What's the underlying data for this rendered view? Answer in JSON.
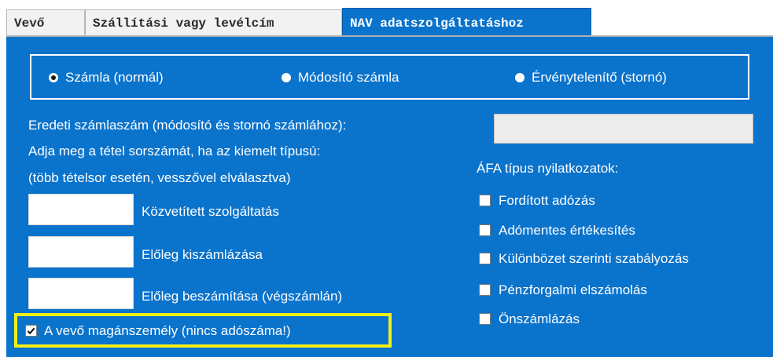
{
  "tabs": [
    {
      "label": "Vevő"
    },
    {
      "label": "Szállítási vagy levélcím"
    },
    {
      "label": "NAV adatszolgáltatáshoz"
    }
  ],
  "invoice_type": {
    "options": [
      "Számla (normál)",
      "Módosító számla",
      "Érvénytelenítő (stornó)"
    ],
    "selected": "Számla (normál)"
  },
  "original_invoice": {
    "label": "Eredeti számlaszám (módosító és stornó számlához):",
    "value": ""
  },
  "item_instructions": {
    "line1": "Adja meg a tétel sorszámát, ha az kiemelt típusú:",
    "line2": "(több tételsor esetén, vesszővel elválasztva)"
  },
  "item_fields": [
    {
      "label": "Közvetített szolgáltatás",
      "value": ""
    },
    {
      "label": "Előleg kiszámlázása",
      "value": ""
    },
    {
      "label": "Előleg beszámítása (végszámlán)",
      "value": ""
    }
  ],
  "vat": {
    "title": "ÁFA típus nyilatkozatok:",
    "options": [
      {
        "label": "Fordított adózás",
        "checked": false
      },
      {
        "label": "Adómentes értékesítés",
        "checked": false
      },
      {
        "label": "Különbözet szerinti szabályozás",
        "checked": false
      },
      {
        "label": "Pénzforgalmi elszámolás",
        "checked": false
      },
      {
        "label": "Önszámlázás",
        "checked": false
      }
    ]
  },
  "private_person": {
    "label": "A vevő magánszemély (nincs adószáma!)",
    "checked": true,
    "highlight_color": "#f4f016"
  },
  "colors": {
    "panel": "#0a73cc",
    "text": "#ffffff"
  }
}
